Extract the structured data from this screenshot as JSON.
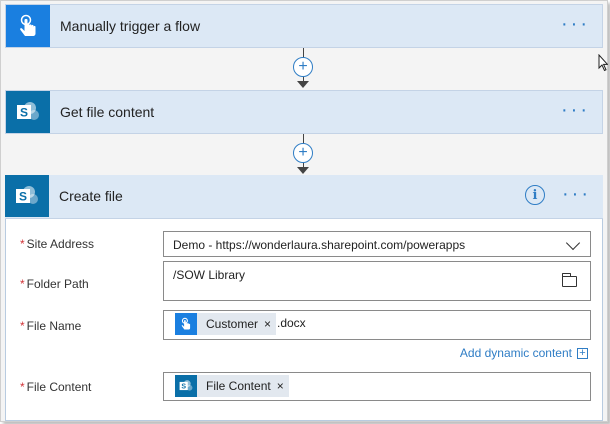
{
  "steps": {
    "trigger": {
      "title": "Manually trigger a flow",
      "icon": "hand-touch-icon",
      "more": "···"
    },
    "get_file": {
      "title": "Get file content",
      "icon": "sharepoint-icon",
      "more": "···"
    },
    "create_file": {
      "title": "Create file",
      "icon": "sharepoint-icon",
      "more": "···",
      "info": "i",
      "fields": {
        "site_address": {
          "required_mark": "*",
          "label": "Site Address",
          "value": "Demo - https://wonderlaura.sharepoint.com/powerapps"
        },
        "folder_path": {
          "required_mark": "*",
          "label": "Folder Path",
          "value": "/SOW Library"
        },
        "file_name": {
          "required_mark": "*",
          "label": "File Name",
          "token": "Customer",
          "token_remove": "×",
          "suffix": ".docx"
        },
        "file_content": {
          "required_mark": "*",
          "label": "File Content",
          "token": "File Content",
          "token_remove": "×"
        }
      },
      "add_dynamic_content": "Add dynamic content",
      "add_dynamic_plus": "+"
    }
  },
  "connector_plus": "+",
  "colors": {
    "accent": "#2f7dc5",
    "trigger_tile": "#1a7fe0",
    "sharepoint_tile": "#0a6fa8",
    "header_bg": "#dce8f5",
    "required": "#d13438"
  }
}
